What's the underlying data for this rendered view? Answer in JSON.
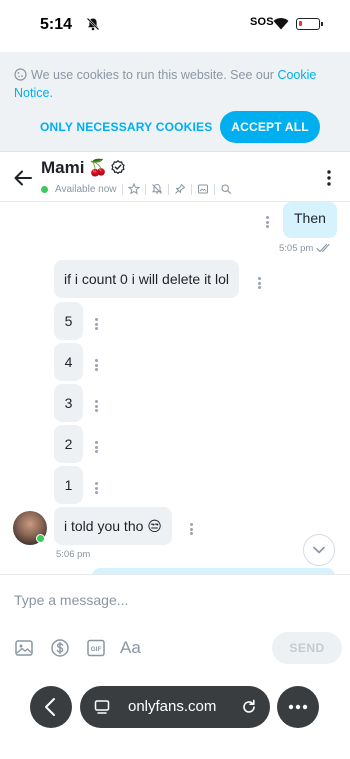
{
  "status_bar": {
    "time": "5:14",
    "sos": "SOS",
    "icons": [
      "bell-off-icon",
      "wifi-icon",
      "battery-low-icon"
    ]
  },
  "cookie_banner": {
    "text": "We use cookies to run this website. See our",
    "link": "Cookie Notice",
    "suffix": ".",
    "necessary_label": "ONLY NECESSARY COOKIES",
    "accept_label": "ACCEPT ALL"
  },
  "chat_header": {
    "name": "Mami",
    "emoji": "🍒",
    "status": "Available now",
    "status_color": "#3dc85a",
    "actions": [
      "star-icon",
      "bell-off-icon",
      "pin-icon",
      "gallery-icon",
      "search-icon"
    ]
  },
  "messages": {
    "outgoing_1": {
      "text": "Then",
      "time": "5:05 pm"
    },
    "incoming": [
      {
        "text": "if i count 0 i will delete it lol"
      },
      {
        "text": "5"
      },
      {
        "text": "4"
      },
      {
        "text": "3"
      },
      {
        "text": "2"
      },
      {
        "text": "1"
      },
      {
        "text": "i told you tho 😒"
      }
    ],
    "incoming_time": "5:06 pm"
  },
  "composer": {
    "placeholder": "Type a message...",
    "format_label": "Aa",
    "send_label": "SEND",
    "tools": [
      "image-icon",
      "dollar-icon",
      "gif-icon"
    ]
  },
  "browser": {
    "url": "onlyfans.com"
  },
  "colors": {
    "accent": "#00aff0",
    "outgoing_bubble": "#d6f3fd",
    "incoming_bubble": "#eef1f4",
    "browser_chrome": "#3a3d40"
  }
}
